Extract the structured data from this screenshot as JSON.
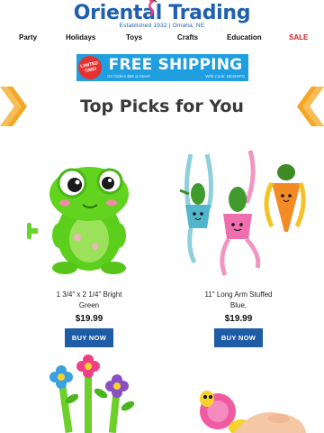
{
  "brand": {
    "name": "Oriental Trading",
    "tagline": "Established 1932 | Omaha, NE",
    "blue": "#1f5fb2"
  },
  "nav": {
    "items": [
      "Party",
      "Holidays",
      "Toys",
      "Crafts",
      "Education"
    ],
    "sale": "SALE",
    "sale_color": "#d21f1f"
  },
  "banner": {
    "badge": "LIMITED TIME!",
    "title": "FREE SHIPPING",
    "subtitle": "On Orders $69 or More*",
    "code": "With Code: DESHIPG",
    "color": "#1f9ee0"
  },
  "section": {
    "title": "Top Picks for You"
  },
  "products": [
    {
      "name": "1 3/4\" x 2 1/4\" Bright Green",
      "price": "$19.99",
      "button": "BUY NOW",
      "image": "wind-up-frog-toy"
    },
    {
      "name": "11\" Long Arm Stuffed Blue,",
      "price": "$19.99",
      "button": "BUY NOW",
      "image": "long-arm-plant-plush-toys"
    }
  ],
  "more_products": [
    {
      "image": "flower-pens"
    },
    {
      "image": "snail-squishy-toy"
    }
  ],
  "colors": {
    "button": "#1e5da6",
    "arrow": "#f5a623"
  }
}
